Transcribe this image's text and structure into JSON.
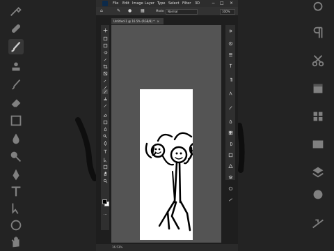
{
  "app": {
    "menu": [
      "File",
      "Edit",
      "Image",
      "Layer",
      "Type",
      "Select",
      "Filter",
      "3D"
    ],
    "logo_text": "Ps",
    "window_controls": [
      "−",
      "□",
      "×"
    ]
  },
  "options_bar": {
    "mode_label": "Mode:",
    "mode_value": "Normal",
    "opacity_value": "100%"
  },
  "document": {
    "tab_label": "Untitled-1 @ 16.5% (RGB/8) *",
    "tab_close": "×"
  },
  "status_bar": {
    "zoom": "16.53%"
  },
  "toolbar": {
    "tools": [
      "move-icon",
      "artboard-icon",
      "marquee-icon",
      "lasso-icon",
      "quick-select-icon",
      "crop-icon",
      "frame-icon",
      "eyedropper-icon",
      "healing-icon",
      "brush-icon",
      "stamp-icon",
      "history-brush-icon",
      "eraser-icon",
      "gradient-icon",
      "blur-icon",
      "dodge-icon",
      "pen-icon",
      "type-icon",
      "path-select-icon",
      "shape-icon",
      "hand-icon",
      "zoom-icon",
      "edit-toolbar-icon"
    ],
    "active_tool": "brush-icon",
    "foreground_color": "#000000",
    "background_color": "#ffffff"
  },
  "right_panel": {
    "buttons": [
      "collapse-icon",
      "history-icon",
      "properties-icon",
      "character-icon",
      "paragraph-icon",
      "glyphs-icon",
      "brushes-icon",
      "color-icon",
      "swatches-icon",
      "adjustments-icon",
      "libraries-icon",
      "shapes-icon",
      "layers-icon",
      "channels-icon",
      "paths-icon"
    ]
  },
  "background_right_icons": [
    "type-tool-large-icon",
    "paragraph-large-icon",
    "scissors-large-icon",
    "frame-large-icon",
    "swatches-large-icon",
    "adjustments-large-icon",
    "layers-large-icon",
    "channels-large-icon",
    "paths-large-icon"
  ],
  "background_left_icons": [
    "eyedropper-large-icon",
    "healing-large-icon",
    "brush-large-icon",
    "stamp-large-icon",
    "history-brush-large-icon",
    "eraser-large-icon",
    "gradient-large-icon",
    "blur-large-icon",
    "dodge-large-icon",
    "pen-large-icon",
    "type-large-icon",
    "path-select-large-icon",
    "shape-large-icon",
    "hand-large-icon"
  ]
}
